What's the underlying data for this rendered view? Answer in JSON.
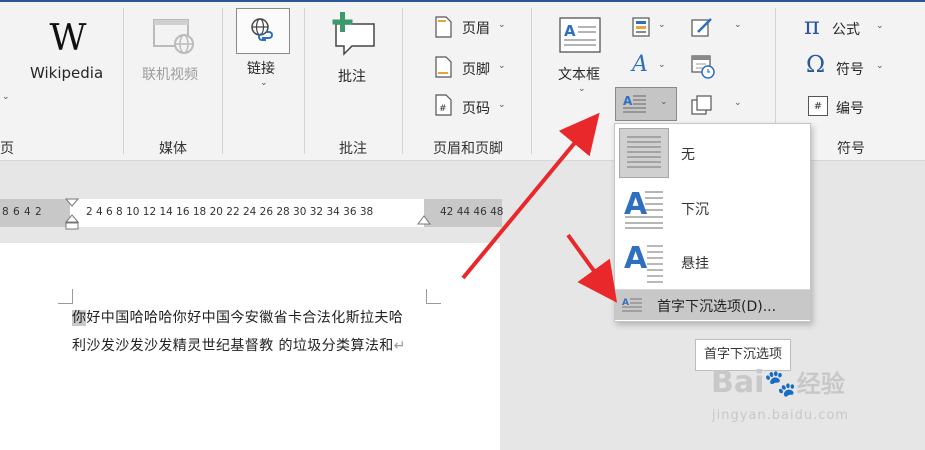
{
  "ribbon": {
    "wikipedia": {
      "label": "Wikipedia"
    },
    "media": {
      "online_video_label": "联机视频",
      "group_label": "媒体"
    },
    "links": {
      "label": "链接",
      "group_label": ""
    },
    "comments": {
      "comment_label": "批注",
      "group_label": "批注"
    },
    "header_footer": {
      "header_label": "页眉",
      "footer_label": "页脚",
      "page_number_label": "页码",
      "group_label": "页眉和页脚"
    },
    "text": {
      "textbox_label": "文本框",
      "group_label": ""
    },
    "symbols": {
      "equation_label": "公式",
      "symbol_label": "符号",
      "number_label": "编号",
      "group_label": "符号"
    },
    "left_fragment_label": "页"
  },
  "ruler": {
    "left_numbers": "8  6  4  2",
    "mid_numbers": "2  4  6  8  10 12 14 16 18 20 22 24 26 28 30 32 34 36 38",
    "right_numbers": "42 44 46 48"
  },
  "document": {
    "line1_first_char": "你",
    "line1_rest": "好中国哈哈哈你好中国今安徽省卡合法化斯拉夫哈",
    "line2": "利沙发沙发沙发精灵世纪基督教 的垃圾分类算法和",
    "paragraph_mark": "↵"
  },
  "dropcap_menu": {
    "items": [
      {
        "label": "无"
      },
      {
        "label": "下沉"
      },
      {
        "label": "悬挂"
      },
      {
        "label": "首字下沉选项(D)..."
      }
    ]
  },
  "tooltip": {
    "text": "首字下沉选项"
  },
  "watermark": {
    "brand": "Bai",
    "brand_cn": "经验",
    "url": "jingyan.baidu.com"
  },
  "colors": {
    "accent": "#2b579a",
    "icon_blue": "#2f6fc0",
    "arrow_red": "#e8282b",
    "highlight": "#c8c8c8"
  }
}
